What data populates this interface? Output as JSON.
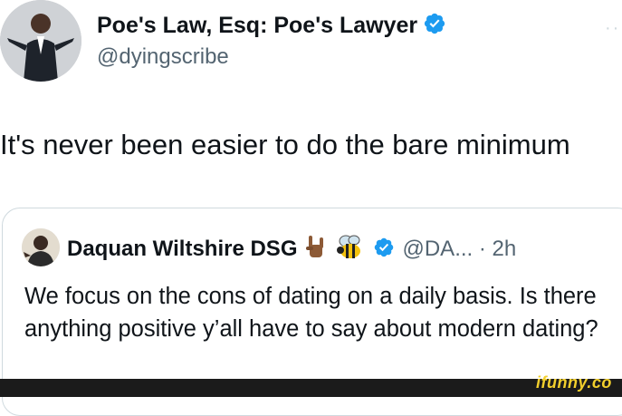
{
  "author": {
    "display_name": "Poe's Law, Esq: Poe's Lawyer",
    "handle": "@dyingscribe",
    "verified_icon": "verified-badge-icon"
  },
  "tweet": {
    "text": "It's never been easier to do the bare minimum"
  },
  "quoted": {
    "display_name": "Daquan Wiltshire DSG",
    "emojis": [
      "rock-on-hand-icon",
      "bee-icon"
    ],
    "handle_time": "@DA... · 2h",
    "text": "We focus on the cons of dating on a daily basis. Is there anything positive y’all have to say about modern dating?"
  },
  "watermark": {
    "text": "ifunny.co"
  },
  "colors": {
    "verified_blue": "#1d9bf0",
    "handle_gray": "#536471",
    "watermark_yellow": "#f2cf2c"
  }
}
